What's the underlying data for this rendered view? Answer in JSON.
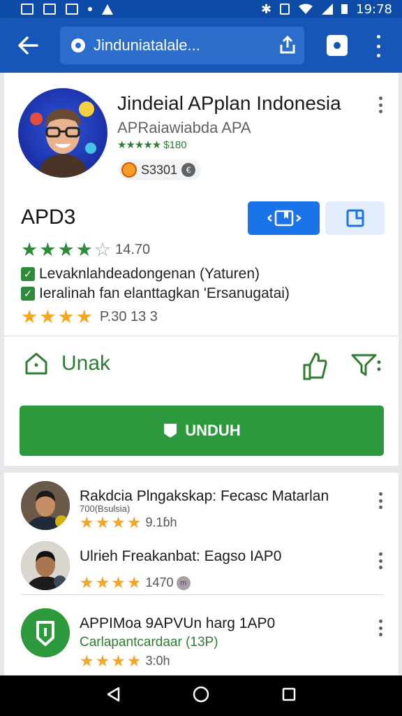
{
  "status_bar": {
    "time": "19:78"
  },
  "toolbar": {
    "back_icon": "arrow-left-icon",
    "url": "Jinduniatalale...",
    "site_icon": "puzzle-icon",
    "share_icon": "share-icon",
    "tabs_icon": "tab-switcher-icon",
    "menu_icon": "overflow-menu-icon"
  },
  "app": {
    "title": "Jindeial APplan Indonesia",
    "developer": "APRaiawiabda APA",
    "rating_text": "$180",
    "chip_value": "S3301",
    "chip_icon_text": "€"
  },
  "section": {
    "title": "APD3",
    "rating_value": "14.70",
    "features": [
      "Levaknlahdeadongenan (Yaturen)",
      "Ieralinah fan elanttagkan 'Ersanugatai)"
    ],
    "orange_rating_text": "P.30  13 3"
  },
  "actions": {
    "home_label": "Unak",
    "download_label": "UNDUH"
  },
  "list": [
    {
      "title": "Rakdcia Plngakskap: Fecasc Matarlan",
      "subtitle": "700(Bsulsia)",
      "rating_value": "9.1ɓh"
    },
    {
      "title": "Ulrieh Freakanbat: Eagso IAP0",
      "subtitle": "",
      "rating_value": "1470",
      "badge": "m"
    },
    {
      "title": "APPIMoa 9APVUn harg 1AP0",
      "subtitle": "Carlapantcardaar (13P)",
      "rating_value": "3:0h"
    }
  ],
  "colors": {
    "primary_blue": "#1656b6",
    "accent_green": "#2c9a3c",
    "star_orange": "#f5a623"
  }
}
